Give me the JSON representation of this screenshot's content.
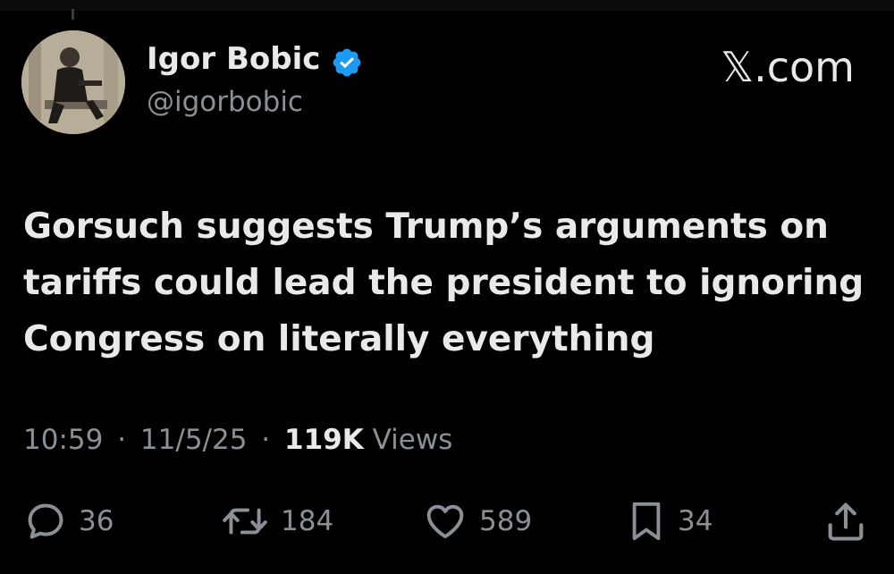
{
  "author": {
    "name": "Igor Bobic",
    "handle": "@igorbobic",
    "verified_icon": "verified-badge-icon"
  },
  "site": {
    "label": "𝕏.com"
  },
  "tweet": {
    "lines": [
      "Gorsuch suggests Trump’s arguments on",
      "tariffs could lead the president to ignoring",
      "Congress on literally everything"
    ]
  },
  "meta": {
    "time": "10:59",
    "separator": "·",
    "date": "11/5/25",
    "views_count": "119K",
    "views_label": "Views"
  },
  "actions": {
    "replies": "36",
    "reposts": "184",
    "likes": "589",
    "bookmarks": "34"
  },
  "colors": {
    "background": "#000000",
    "text": "#e7e9ea",
    "secondary": "#8b9096",
    "verified": "#1d9bf0"
  }
}
